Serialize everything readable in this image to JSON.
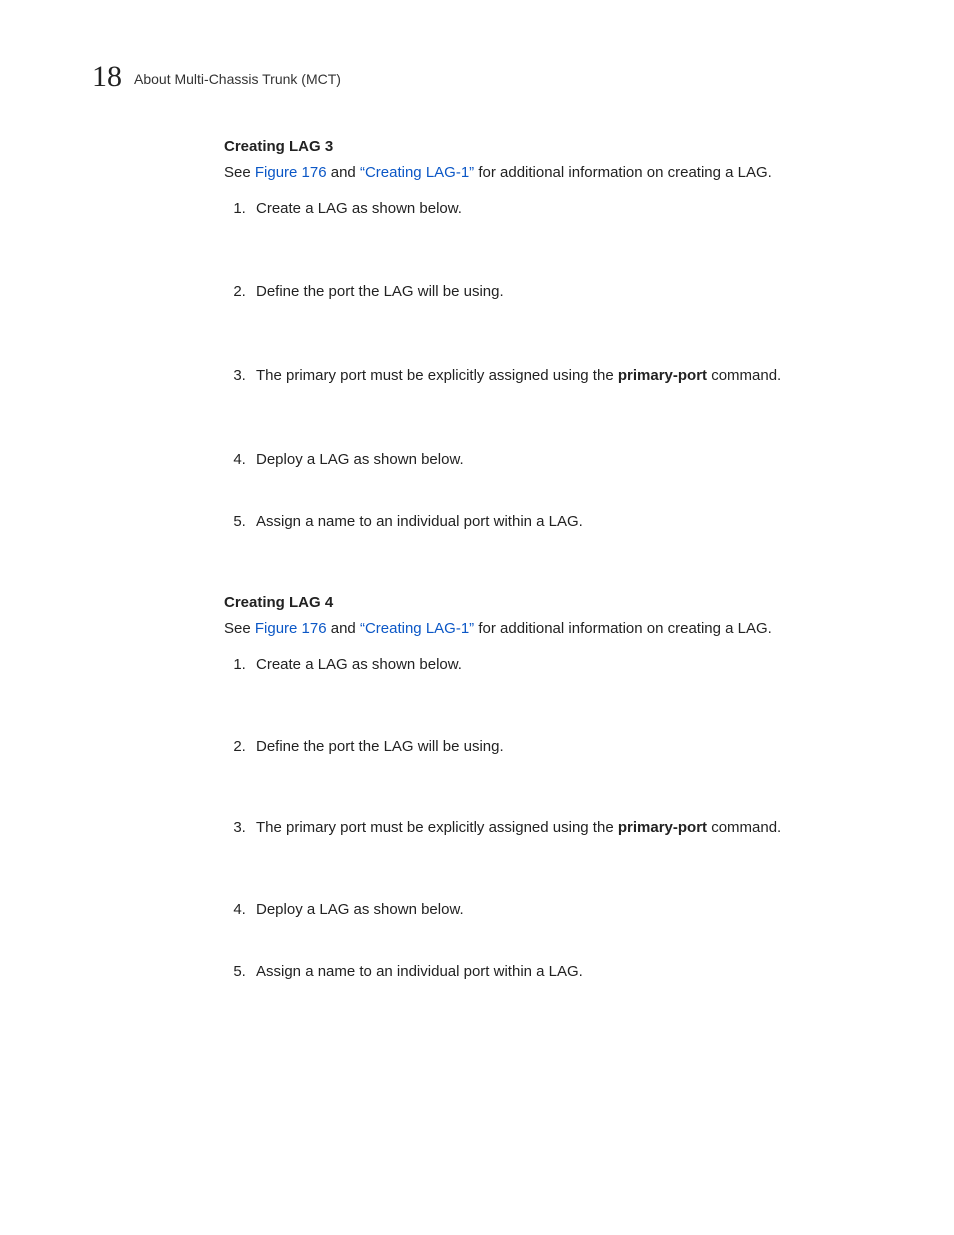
{
  "header": {
    "chapter_number": "18",
    "running_head": "About Multi-Chassis Trunk (MCT)"
  },
  "sections": [
    {
      "title": "Creating LAG 3",
      "intro_prefix": "See ",
      "fig_link": "Figure 176",
      "intro_mid": " and ",
      "xref_open": "“",
      "xref": "Creating LAG-1",
      "xref_close": "”",
      "intro_suffix": " for additional information on creating a LAG.",
      "steps": [
        {
          "text_before": "Create a LAG as shown below."
        },
        {
          "text_before": "Define the port the LAG will be using."
        },
        {
          "text_before": "The primary port must be explicitly assigned using the ",
          "cmd": "primary-port",
          "text_after": " command."
        },
        {
          "text_before": "Deploy a LAG as shown below."
        },
        {
          "text_before": "Assign a name to an individual port within a LAG."
        }
      ]
    },
    {
      "title": "Creating LAG 4",
      "intro_prefix": "See ",
      "fig_link": "Figure 176",
      "intro_mid": " and ",
      "xref_open": "“",
      "xref": "Creating LAG-1",
      "xref_close": "”",
      "intro_suffix": " for additional information on creating a LAG.",
      "steps": [
        {
          "text_before": "Create a LAG as shown below."
        },
        {
          "text_before": "Define the port the LAG will be using."
        },
        {
          "text_before": "The primary port must be explicitly assigned using the ",
          "cmd": "primary-port",
          "text_after": " command."
        },
        {
          "text_before": "Deploy a LAG as shown below."
        },
        {
          "text_before": "Assign a name to an individual port within a LAG."
        }
      ]
    }
  ]
}
